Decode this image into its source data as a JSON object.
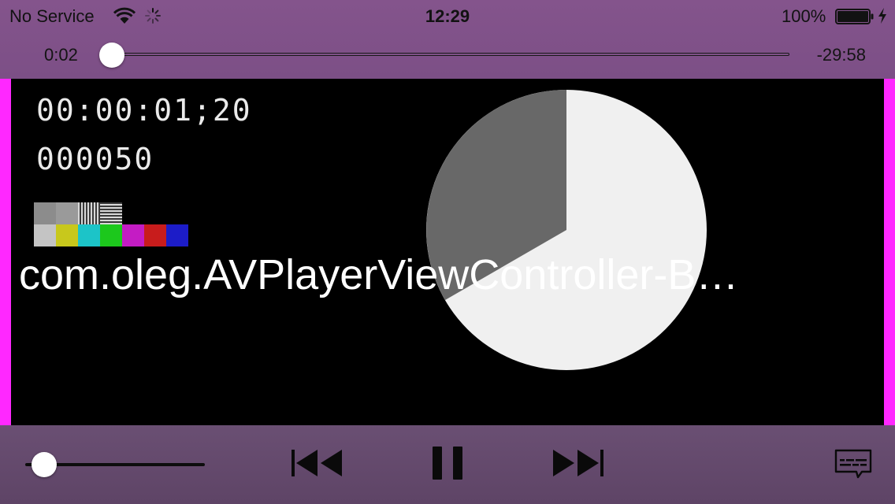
{
  "status_bar": {
    "carrier": "No Service",
    "time": "12:29",
    "battery_percent": "100%",
    "battery_level": 1.0,
    "wifi_icon": "wifi-icon",
    "activity_icon": "activity-spinner-icon",
    "charging_icon": "charging-bolt-icon"
  },
  "scrubber": {
    "elapsed": "0:02",
    "remaining": "-29:58",
    "progress": 0.001
  },
  "video": {
    "timecode": "00:00:01;20",
    "frame_count": "000050",
    "title": "com.oleg.AVPlayerViewController-B…",
    "edge_color": "#ff28ff",
    "color_bars_top": [
      "#8c8c8c",
      "#9a9a9a",
      "gray-vertical-stripes",
      "gray-horizontal-stripes"
    ],
    "color_bars_bottom": [
      "#c4c4c4",
      "#c8c81c",
      "#1cc4c8",
      "#1cc81c",
      "#c41cc4",
      "#c81c1c",
      "#1c1cc8"
    ]
  },
  "controls": {
    "volume_level": 0.1,
    "prev_icon": "skip-back-icon",
    "pause_icon": "pause-icon",
    "next_icon": "skip-forward-icon",
    "subtitles_icon": "subtitles-icon"
  },
  "colors": {
    "bar_tint": "#7d5085",
    "accent_pink": "#ff28ff"
  }
}
